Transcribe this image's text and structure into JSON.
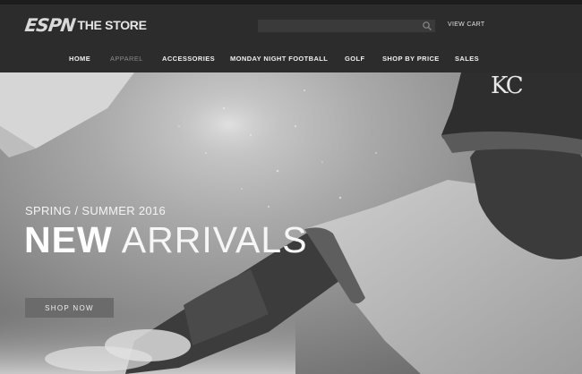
{
  "brand": {
    "logo_mark": "ESPN",
    "store_label": "THE STORE"
  },
  "search": {
    "placeholder": "",
    "icon": "search-icon"
  },
  "header": {
    "view_cart_label": "VIEW CART"
  },
  "nav": {
    "items": [
      {
        "label": "HOME",
        "active": false
      },
      {
        "label": "APPAREL",
        "active": true
      },
      {
        "label": "ACCESSORIES",
        "active": false
      },
      {
        "label": "MONDAY NIGHT FOOTBALL",
        "active": false
      },
      {
        "label": "GOLF",
        "active": false
      },
      {
        "label": "SHOP BY PRICE",
        "active": false
      },
      {
        "label": "SALES",
        "active": false
      }
    ]
  },
  "hero": {
    "season_label": "SPRING / SUMMER 2016",
    "headline_strong": "NEW",
    "headline_light": "ARRIVALS",
    "cta_label": "SHOP NOW",
    "helmet_logo": "KC"
  },
  "colors": {
    "header_bg": "#2c2c2c",
    "nav_active": "#8a8a8a",
    "cta_bg": "#6b6b6b"
  }
}
